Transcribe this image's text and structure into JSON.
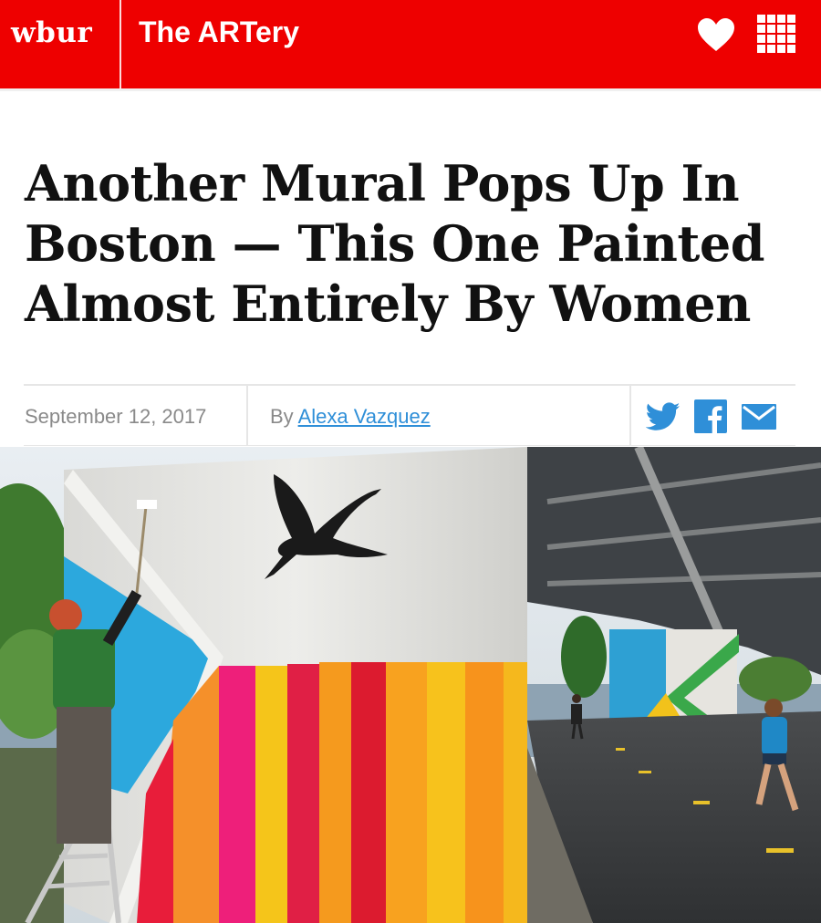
{
  "header": {
    "logo_text": "wbur",
    "section_title": "The ARTery",
    "background_color": "#ee0000",
    "icons": [
      "heart-icon",
      "grid-menu-icon"
    ]
  },
  "article": {
    "headline": "Another Mural Pops Up In Boston — This One Painted Almost Entirely By Women",
    "date": "September 12, 2017",
    "byline_prefix": "By",
    "author": "Alexa Vazquez",
    "link_color": "#2f8fd8"
  },
  "share": {
    "icons": [
      "twitter-icon",
      "facebook-icon",
      "email-icon"
    ],
    "color": "#2f8fd8"
  },
  "hero_image": {
    "subject": "mural-under-overpass-photo"
  }
}
